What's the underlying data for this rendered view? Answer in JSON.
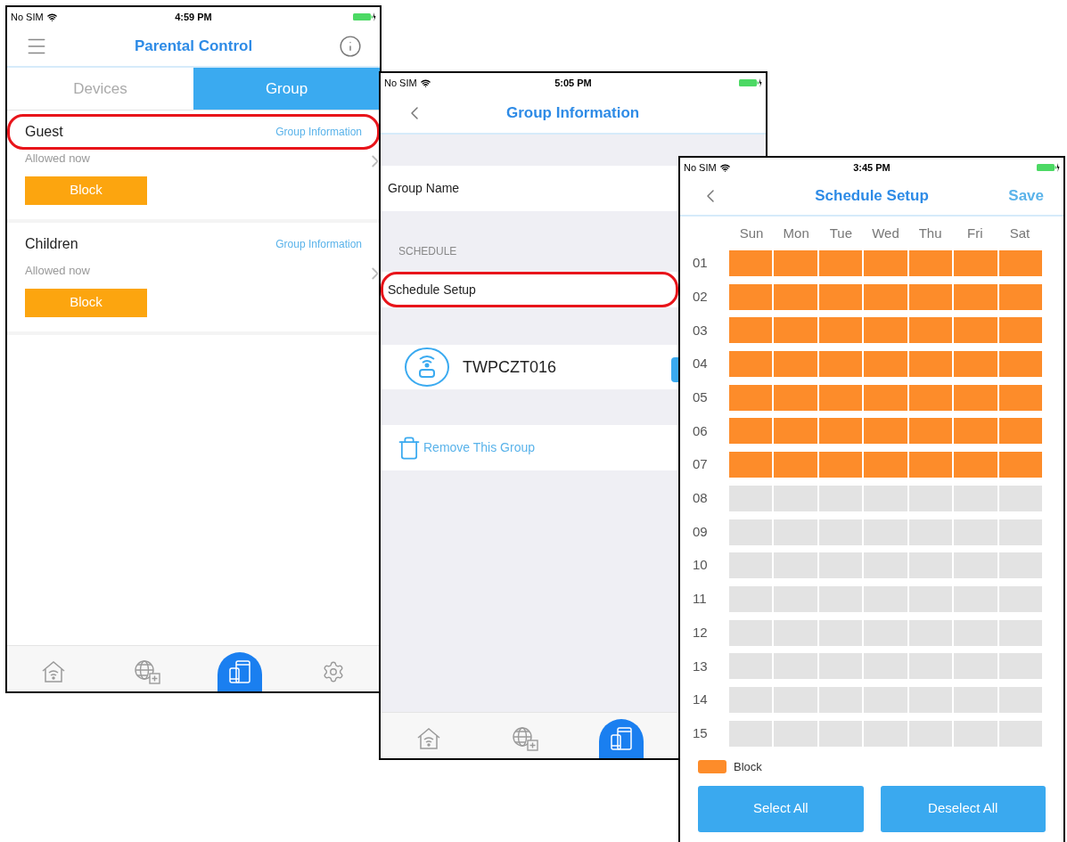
{
  "parental_control": {
    "status_bar": {
      "carrier": "No SIM",
      "time": "4:59 PM"
    },
    "title": "Parental Control",
    "tabs": [
      {
        "label": "Devices",
        "selected": false
      },
      {
        "label": "Group",
        "selected": true
      }
    ],
    "groups": [
      {
        "name": "Guest",
        "link": "Group Information",
        "status": "Allowed now",
        "button": "Block",
        "highlighted": true
      },
      {
        "name": "Children",
        "link": "Group Information",
        "status": "Allowed now",
        "button": "Block",
        "highlighted": false
      }
    ],
    "tab_bar": [
      {
        "kind": "home",
        "selected": false
      },
      {
        "kind": "globe",
        "selected": false
      },
      {
        "kind": "devices",
        "selected": true
      },
      {
        "kind": "settings",
        "selected": false
      }
    ]
  },
  "group_information": {
    "status_bar": {
      "carrier": "No SIM",
      "time": "5:05 PM"
    },
    "title": "Group Information",
    "group_name_label": "Group Name",
    "section_header": "SCHEDULE",
    "schedule_row": {
      "label": "Schedule Setup",
      "highlighted": true
    },
    "device": {
      "name": "TWPCZT016"
    },
    "remove_label": "Remove This Group",
    "tab_bar": [
      {
        "kind": "home",
        "selected": false
      },
      {
        "kind": "globe",
        "selected": false
      },
      {
        "kind": "devices",
        "selected": true
      }
    ]
  },
  "schedule_setup": {
    "status_bar": {
      "carrier": "No SIM",
      "time": "3:45 PM"
    },
    "title": "Schedule Setup",
    "save": "Save",
    "days": [
      "Sun",
      "Mon",
      "Tue",
      "Wed",
      "Thu",
      "Fri",
      "Sat"
    ],
    "rows": [
      {
        "label": "01",
        "cells": [
          {
            "blocked": true
          },
          {
            "blocked": true
          },
          {
            "blocked": true
          },
          {
            "blocked": true
          },
          {
            "blocked": true
          },
          {
            "blocked": true
          },
          {
            "blocked": true
          }
        ]
      },
      {
        "label": "02",
        "cells": [
          {
            "blocked": true
          },
          {
            "blocked": true
          },
          {
            "blocked": true
          },
          {
            "blocked": true
          },
          {
            "blocked": true
          },
          {
            "blocked": true
          },
          {
            "blocked": true
          }
        ]
      },
      {
        "label": "03",
        "cells": [
          {
            "blocked": true
          },
          {
            "blocked": true
          },
          {
            "blocked": true
          },
          {
            "blocked": true
          },
          {
            "blocked": true
          },
          {
            "blocked": true
          },
          {
            "blocked": true
          }
        ]
      },
      {
        "label": "04",
        "cells": [
          {
            "blocked": true
          },
          {
            "blocked": true
          },
          {
            "blocked": true
          },
          {
            "blocked": true
          },
          {
            "blocked": true
          },
          {
            "blocked": true
          },
          {
            "blocked": true
          }
        ]
      },
      {
        "label": "05",
        "cells": [
          {
            "blocked": true
          },
          {
            "blocked": true
          },
          {
            "blocked": true
          },
          {
            "blocked": true
          },
          {
            "blocked": true
          },
          {
            "blocked": true
          },
          {
            "blocked": true
          }
        ]
      },
      {
        "label": "06",
        "cells": [
          {
            "blocked": true
          },
          {
            "blocked": true
          },
          {
            "blocked": true
          },
          {
            "blocked": true
          },
          {
            "blocked": true
          },
          {
            "blocked": true
          },
          {
            "blocked": true
          }
        ]
      },
      {
        "label": "07",
        "cells": [
          {
            "blocked": true
          },
          {
            "blocked": true
          },
          {
            "blocked": true
          },
          {
            "blocked": true
          },
          {
            "blocked": true
          },
          {
            "blocked": true
          },
          {
            "blocked": true
          }
        ]
      },
      {
        "label": "08",
        "cells": [
          {
            "blocked": false
          },
          {
            "blocked": false
          },
          {
            "blocked": false
          },
          {
            "blocked": false
          },
          {
            "blocked": false
          },
          {
            "blocked": false
          },
          {
            "blocked": false
          }
        ]
      },
      {
        "label": "09",
        "cells": [
          {
            "blocked": false
          },
          {
            "blocked": false
          },
          {
            "blocked": false
          },
          {
            "blocked": false
          },
          {
            "blocked": false
          },
          {
            "blocked": false
          },
          {
            "blocked": false
          }
        ]
      },
      {
        "label": "10",
        "cells": [
          {
            "blocked": false
          },
          {
            "blocked": false
          },
          {
            "blocked": false
          },
          {
            "blocked": false
          },
          {
            "blocked": false
          },
          {
            "blocked": false
          },
          {
            "blocked": false
          }
        ]
      },
      {
        "label": "11",
        "cells": [
          {
            "blocked": false
          },
          {
            "blocked": false
          },
          {
            "blocked": false
          },
          {
            "blocked": false
          },
          {
            "blocked": false
          },
          {
            "blocked": false
          },
          {
            "blocked": false
          }
        ]
      },
      {
        "label": "12",
        "cells": [
          {
            "blocked": false
          },
          {
            "blocked": false
          },
          {
            "blocked": false
          },
          {
            "blocked": false
          },
          {
            "blocked": false
          },
          {
            "blocked": false
          },
          {
            "blocked": false
          }
        ]
      },
      {
        "label": "13",
        "cells": [
          {
            "blocked": false
          },
          {
            "blocked": false
          },
          {
            "blocked": false
          },
          {
            "blocked": false
          },
          {
            "blocked": false
          },
          {
            "blocked": false
          },
          {
            "blocked": false
          }
        ]
      },
      {
        "label": "14",
        "cells": [
          {
            "blocked": false
          },
          {
            "blocked": false
          },
          {
            "blocked": false
          },
          {
            "blocked": false
          },
          {
            "blocked": false
          },
          {
            "blocked": false
          },
          {
            "blocked": false
          }
        ]
      },
      {
        "label": "15",
        "cells": [
          {
            "blocked": false
          },
          {
            "blocked": false
          },
          {
            "blocked": false
          },
          {
            "blocked": false
          },
          {
            "blocked": false
          },
          {
            "blocked": false
          },
          {
            "blocked": false
          }
        ]
      }
    ],
    "legend": "Block",
    "buttons": [
      "Select All",
      "Deselect All"
    ]
  }
}
